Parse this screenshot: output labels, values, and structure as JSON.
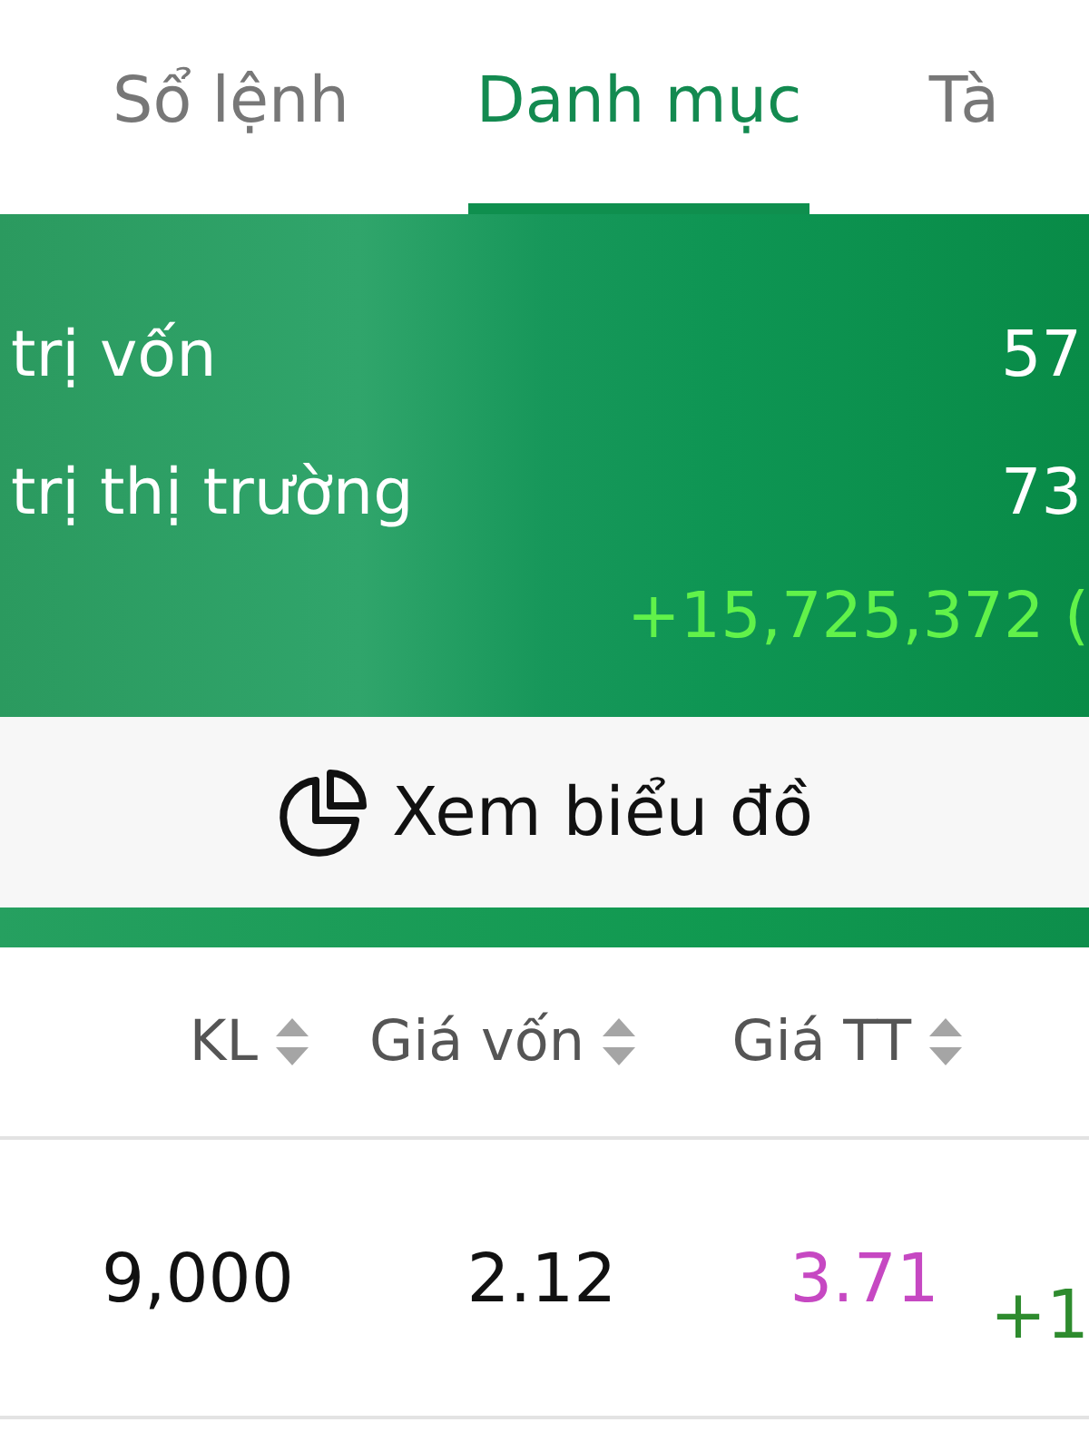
{
  "tabs": [
    {
      "label": "Sổ lệnh",
      "selected": false
    },
    {
      "label": "Danh mục",
      "selected": true
    },
    {
      "label": "Tà",
      "selected": false
    }
  ],
  "summary": {
    "rows": [
      {
        "label": "trị vốn",
        "value": "57"
      },
      {
        "label": "trị thị trường",
        "value": "73"
      }
    ],
    "profit": "+15,725,372 ("
  },
  "chart_button": {
    "label": "Xem biểu đồ"
  },
  "table": {
    "columns": [
      {
        "label": "KL"
      },
      {
        "label": "Giá vốn"
      },
      {
        "label": "Giá TT"
      }
    ],
    "rows": [
      {
        "cells": [
          "9,000",
          "2.12",
          "3.71"
        ],
        "change": "+1"
      }
    ]
  }
}
